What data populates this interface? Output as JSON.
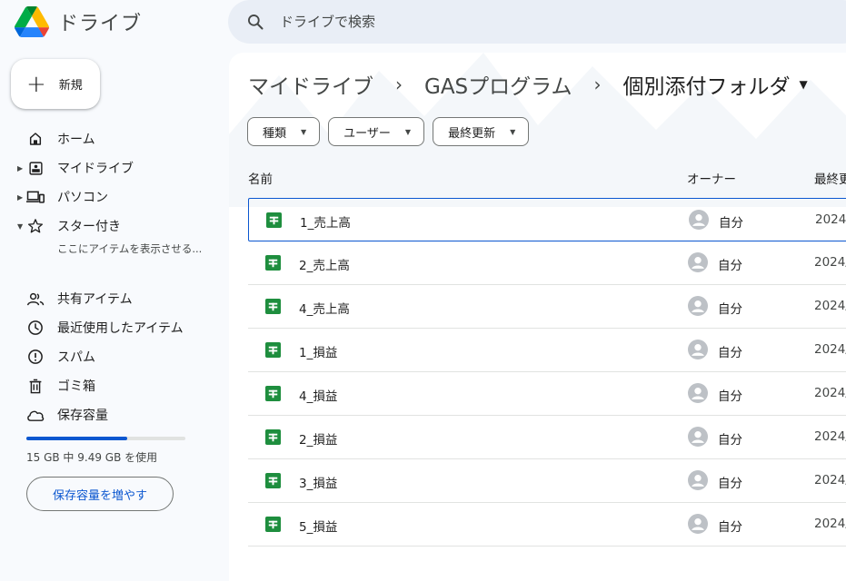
{
  "app": {
    "name": "ドライブ"
  },
  "search": {
    "placeholder": "ドライブで検索"
  },
  "new_button": {
    "label": "新規"
  },
  "nav": [
    {
      "label": "ホーム",
      "icon": "home-icon",
      "name": "nav-home"
    },
    {
      "label": "マイドライブ",
      "icon": "my-drive-icon",
      "name": "nav-my-drive"
    },
    {
      "label": "パソコン",
      "icon": "computer-icon",
      "name": "nav-computers"
    },
    {
      "label": "スター付き",
      "icon": "star-icon",
      "name": "nav-starred"
    },
    {
      "label": "共有アイテム",
      "icon": "shared-icon",
      "name": "nav-shared"
    },
    {
      "label": "最近使用したアイテム",
      "icon": "clock-icon",
      "name": "nav-recent"
    },
    {
      "label": "スパム",
      "icon": "spam-icon",
      "name": "nav-spam"
    },
    {
      "label": "ゴミ箱",
      "icon": "trash-icon",
      "name": "nav-trash"
    },
    {
      "label": "保存容量",
      "icon": "cloud-icon",
      "name": "nav-storage"
    }
  ],
  "starred_hint": "ここにアイテムを表示させる...",
  "storage": {
    "used_fraction": 0.633,
    "text": "15 GB 中 9.49 GB を使用",
    "button": "保存容量を増やす"
  },
  "breadcrumb": {
    "root": "マイドライブ",
    "parent": "GASプログラム",
    "current": "個別添付フォルダ"
  },
  "filters": [
    "種類",
    "ユーザー",
    "最終更新"
  ],
  "columns": {
    "name": "名前",
    "owner": "オーナー",
    "modified": "最終更"
  },
  "files": [
    {
      "name": "1_売上高",
      "owner": "自分",
      "modified": "2024/"
    },
    {
      "name": "2_売上高",
      "owner": "自分",
      "modified": "2024/"
    },
    {
      "name": "4_売上高",
      "owner": "自分",
      "modified": "2024/"
    },
    {
      "name": "1_損益",
      "owner": "自分",
      "modified": "2024/"
    },
    {
      "name": "4_損益",
      "owner": "自分",
      "modified": "2024/"
    },
    {
      "name": "2_損益",
      "owner": "自分",
      "modified": "2024/"
    },
    {
      "name": "3_損益",
      "owner": "自分",
      "modified": "2024/"
    },
    {
      "name": "5_損益",
      "owner": "自分",
      "modified": "2024/"
    }
  ],
  "colors": {
    "accent": "#0b57d0",
    "sheets_green": "#1e8e3e",
    "search_bg": "#e9eef6",
    "page_bg": "#f8fafd"
  }
}
